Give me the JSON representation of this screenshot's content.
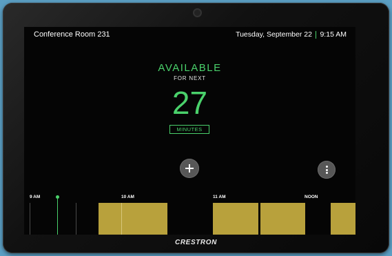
{
  "header": {
    "room_name": "Conference Room 231",
    "date": "Tuesday, September 22",
    "time": "9:15 AM"
  },
  "status": {
    "label": "AVAILABLE",
    "for_next": "FOR NEXT",
    "minutes_value": "27",
    "minutes_label": "MINUTES"
  },
  "actions": {
    "add_icon": "plus-icon",
    "more_icon": "more-vertical-icon"
  },
  "timeline": {
    "labels": [
      "9 AM",
      "10 AM",
      "11 AM",
      "NOON"
    ],
    "booked_color": "#b8a13c",
    "now_color": "#4ad16b"
  },
  "brand": "CRESTRON",
  "colors": {
    "accent": "#4ad16b",
    "booked": "#b8a13c",
    "background": "#050505"
  }
}
